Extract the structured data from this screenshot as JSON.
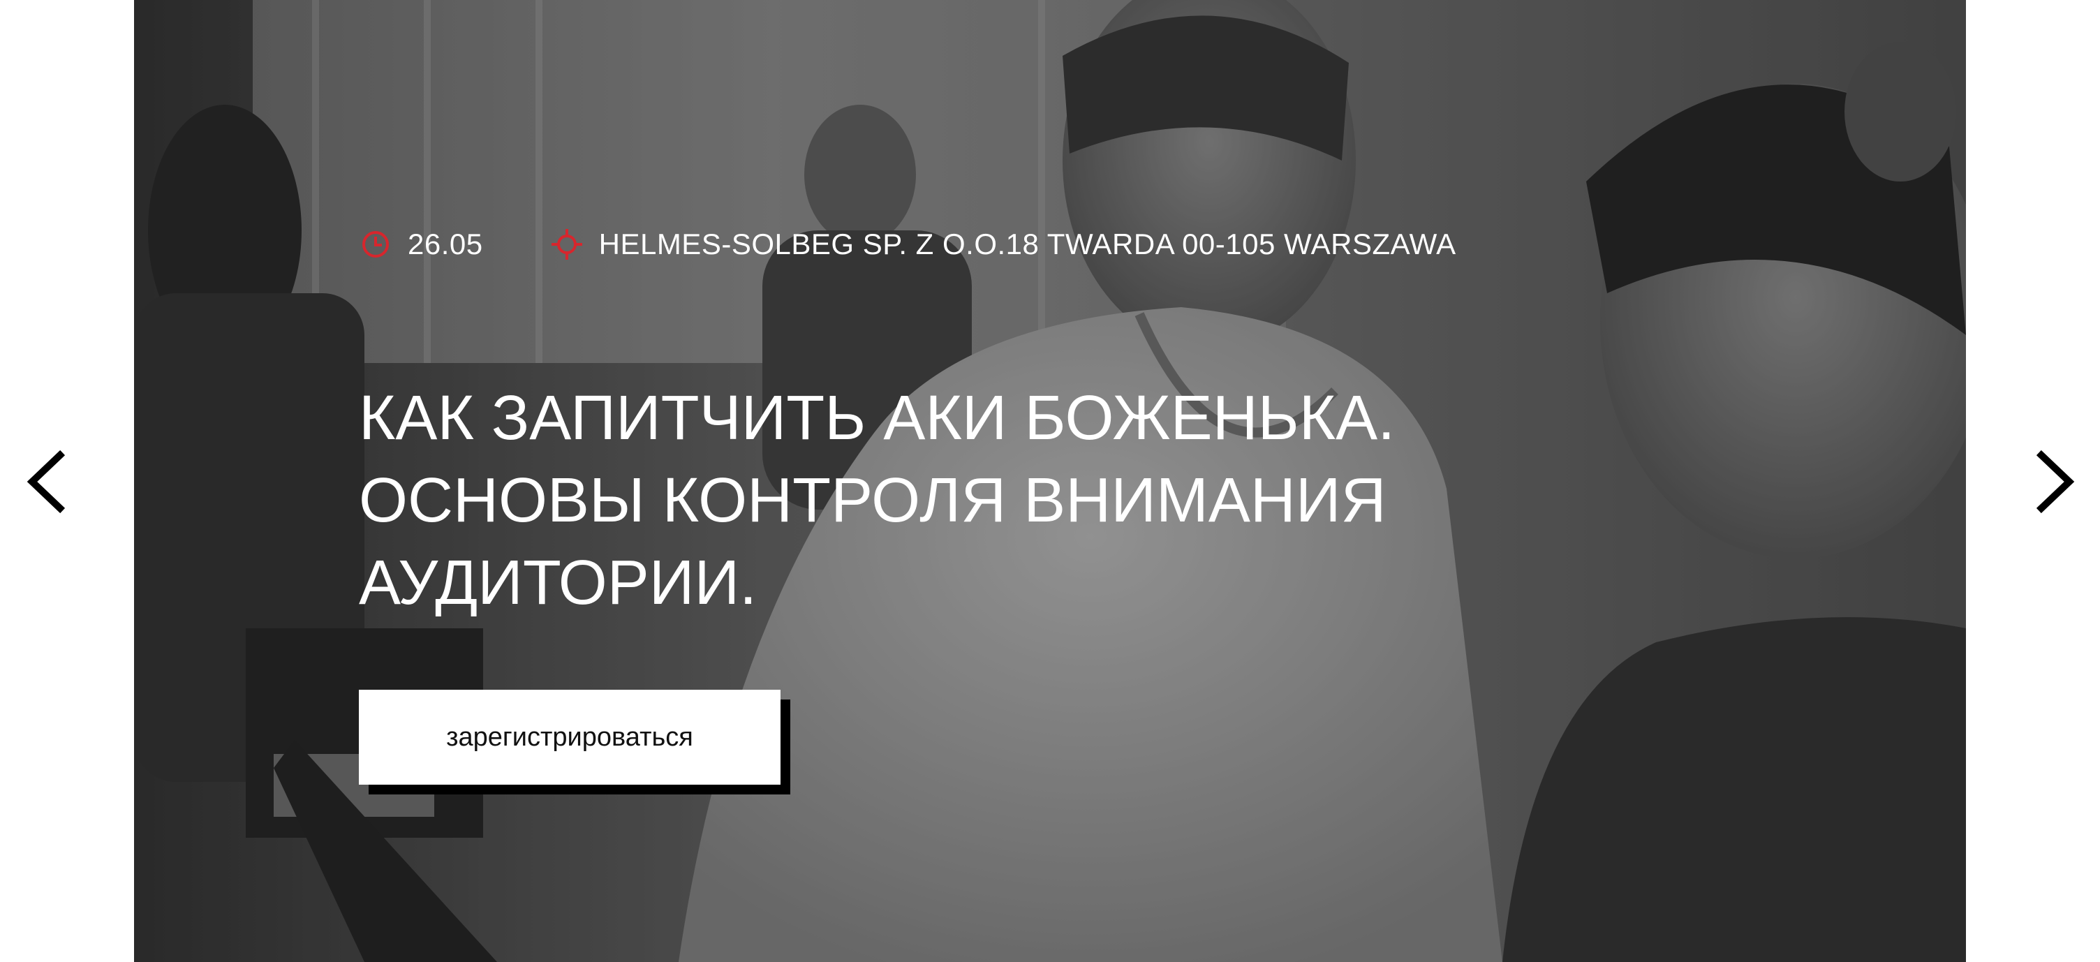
{
  "event": {
    "date": "26.05",
    "date_icon": "clock-icon",
    "location": "HELMES-SOLBEG SP. Z O.O.18 TWARDA 00-105 WARSZAWA",
    "location_icon": "location-target-icon",
    "title": "КАК ЗАПИТЧИТЬ АКИ БОЖЕНЬКА. ОСНОВЫ КОНТРОЛЯ ВНИМАНИЯ АУДИТОРИИ.",
    "register_label": "зарегистрироваться"
  },
  "carousel": {
    "prev_icon": "chevron-left-icon",
    "next_icon": "chevron-right-icon"
  },
  "colors": {
    "accent": "#d7262d",
    "text_on_photo": "#ffffff",
    "button_bg": "#ffffff",
    "button_shadow": "#000000",
    "arrow": "#000000"
  }
}
